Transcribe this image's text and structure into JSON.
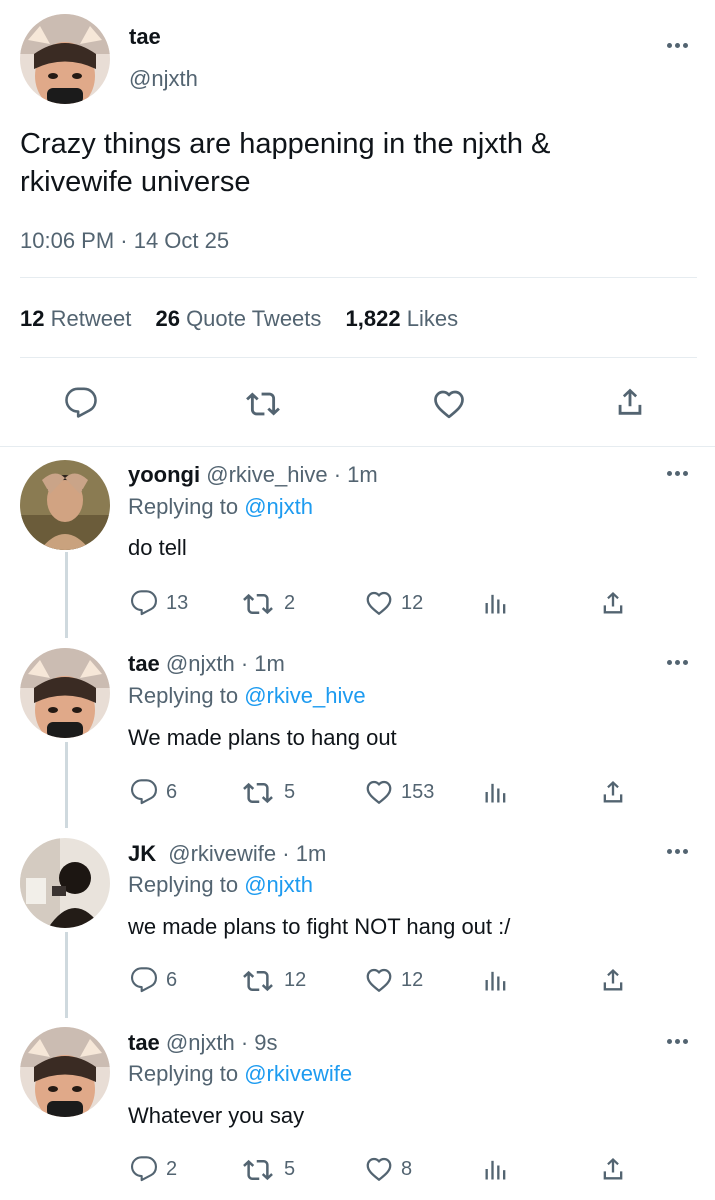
{
  "main_tweet": {
    "name": "tae",
    "handle": "@njxth",
    "text_line1": "Crazy things are happening in the njxth &",
    "text_line2": "rkivewife universe",
    "timestamp": "10:06 PM · 14 Oct 25",
    "stats": {
      "retweets": "12",
      "retweets_label": "Retweet",
      "quotes": "26",
      "quotes_label": "Quote Tweets",
      "likes": "1,822",
      "likes_label": "Likes"
    }
  },
  "replies": [
    {
      "name": "yoongi",
      "handle_time": "@rkive_hive · 1m",
      "replying_prefix": "Replying to",
      "replying_to": "@njxth",
      "text": "do tell",
      "replies": "13",
      "retweets": "2",
      "likes": "12"
    },
    {
      "name": "tae",
      "handle_time": "@njxth · 1m",
      "replying_prefix": "Replying to",
      "replying_to": "@rkive_hive",
      "text": "We made plans to hang out",
      "replies": "6",
      "retweets": "5",
      "likes": "153"
    },
    {
      "name": "JK",
      "handle_time": "@rkivewife · 1m",
      "replying_prefix": "Replying to",
      "replying_to": "@njxth",
      "text": "we made plans to fight NOT hang out :/",
      "replies": "6",
      "retweets": "12",
      "likes": "12"
    },
    {
      "name": "tae",
      "handle_time": "@njxth · 9s",
      "replying_prefix": "Replying to",
      "replying_to": "@rkivewife",
      "text": "Whatever you say",
      "replies": "2",
      "retweets": "5",
      "likes": "8"
    }
  ],
  "icons": {
    "reply": "reply-icon",
    "retweet": "retweet-icon",
    "like": "heart-icon",
    "views": "analytics-icon",
    "share": "share-icon",
    "more": "more-icon"
  },
  "colors": {
    "text": "#0f1419",
    "secondary": "#536471",
    "link": "#1d9bf0",
    "divider": "#e6ecf0"
  }
}
